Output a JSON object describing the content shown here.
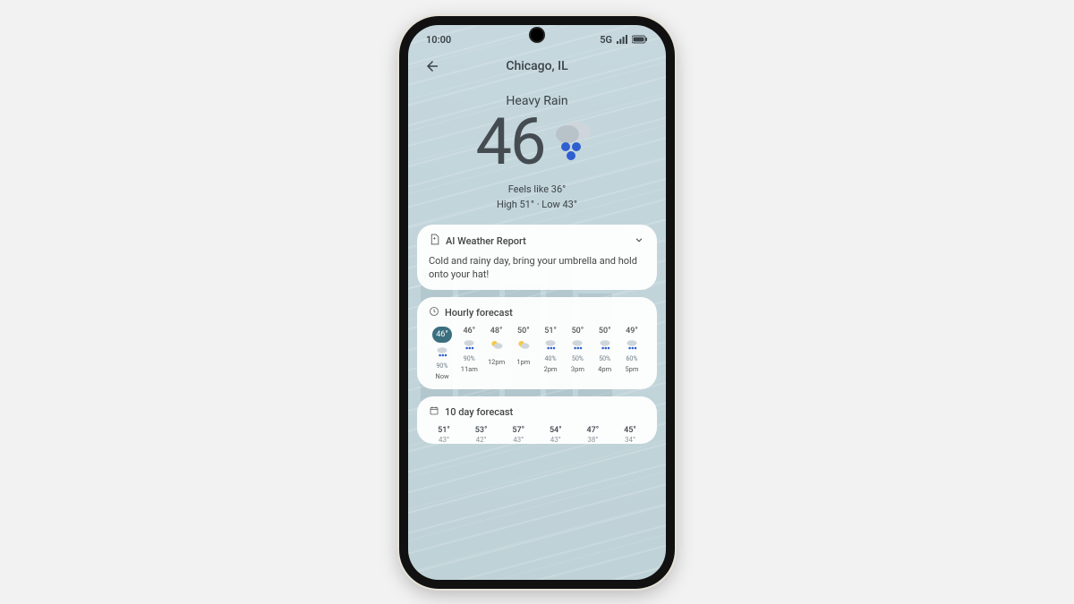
{
  "status": {
    "time": "10:00",
    "network": "5G"
  },
  "header": {
    "location": "Chicago, IL"
  },
  "hero": {
    "condition": "Heavy Rain",
    "temp": "46",
    "feels_like": "Feels like 36°",
    "high_low": "High 51°  ·  Low 43°"
  },
  "ai_report": {
    "title": "AI Weather Report",
    "body": "Cold and rainy day, bring your umbrella and hold onto your hat!"
  },
  "hourly": {
    "title": "Hourly forecast",
    "items": [
      {
        "temp": "46°",
        "pct": "90%",
        "label": "Now",
        "icon": "rain",
        "current": true
      },
      {
        "temp": "46°",
        "pct": "90%",
        "label": "11am",
        "icon": "rain"
      },
      {
        "temp": "48°",
        "pct": "",
        "label": "12pm",
        "icon": "partly"
      },
      {
        "temp": "50°",
        "pct": "",
        "label": "1pm",
        "icon": "partly"
      },
      {
        "temp": "51°",
        "pct": "40%",
        "label": "2pm",
        "icon": "rain"
      },
      {
        "temp": "50°",
        "pct": "50%",
        "label": "3pm",
        "icon": "rain"
      },
      {
        "temp": "50°",
        "pct": "50%",
        "label": "4pm",
        "icon": "rain"
      },
      {
        "temp": "49°",
        "pct": "60%",
        "label": "5pm",
        "icon": "rain"
      }
    ]
  },
  "daily": {
    "title": "10 day forecast",
    "items": [
      {
        "hi": "51°",
        "lo": "43°"
      },
      {
        "hi": "53°",
        "lo": "42°"
      },
      {
        "hi": "57°",
        "lo": "43°"
      },
      {
        "hi": "54°",
        "lo": "43°"
      },
      {
        "hi": "47°",
        "lo": "38°"
      },
      {
        "hi": "45°",
        "lo": "34°"
      }
    ]
  }
}
